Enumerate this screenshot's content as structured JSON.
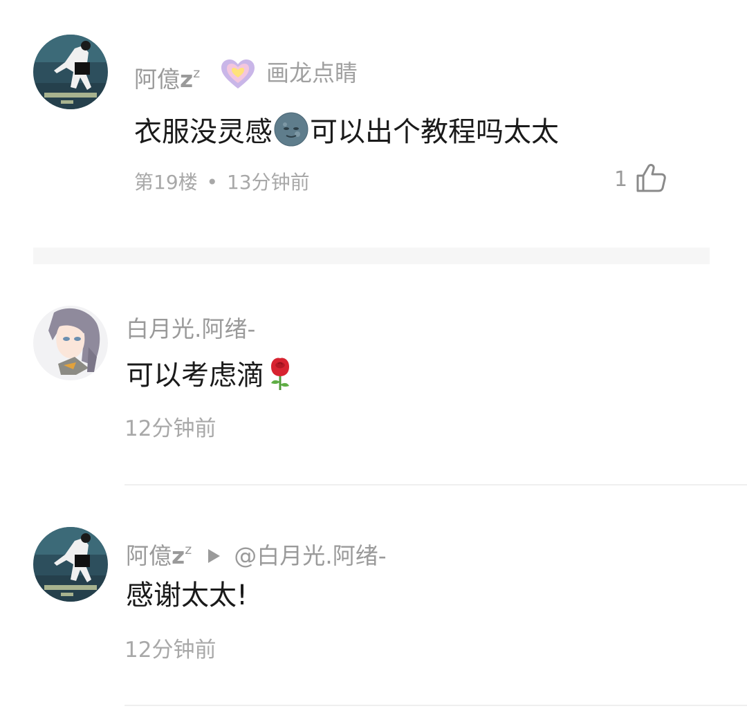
{
  "comments": [
    {
      "username": "阿億",
      "username_suffix_big": "z",
      "username_suffix_small": "z",
      "badge_label": "画龙点睛",
      "content_part1": "衣服没灵感",
      "content_emoji": "new-moon-face",
      "content_part2": "可以出个教程吗太太",
      "floor": "第19楼",
      "dot": "•",
      "time": "13分钟前",
      "like_count": "1"
    },
    {
      "username": "白月光.阿绪-",
      "content": "可以考虑滴",
      "content_emoji": "rose",
      "time": "12分钟前"
    },
    {
      "username": "阿億",
      "username_suffix_big": "z",
      "username_suffix_small": "z",
      "reply_to": "@白月光.阿绪-",
      "content": "感谢太太!",
      "time": "12分钟前"
    }
  ],
  "icons": {
    "like": "thumbs-up-icon",
    "badge": "heart-badge-icon",
    "reply": "reply-arrow-icon"
  },
  "colors": {
    "username": "#9a9a9a",
    "text": "#1a1a1a",
    "meta": "#a8a8a8",
    "badge_outer": "#c9b6e8",
    "badge_inner": "#ffe27a"
  }
}
